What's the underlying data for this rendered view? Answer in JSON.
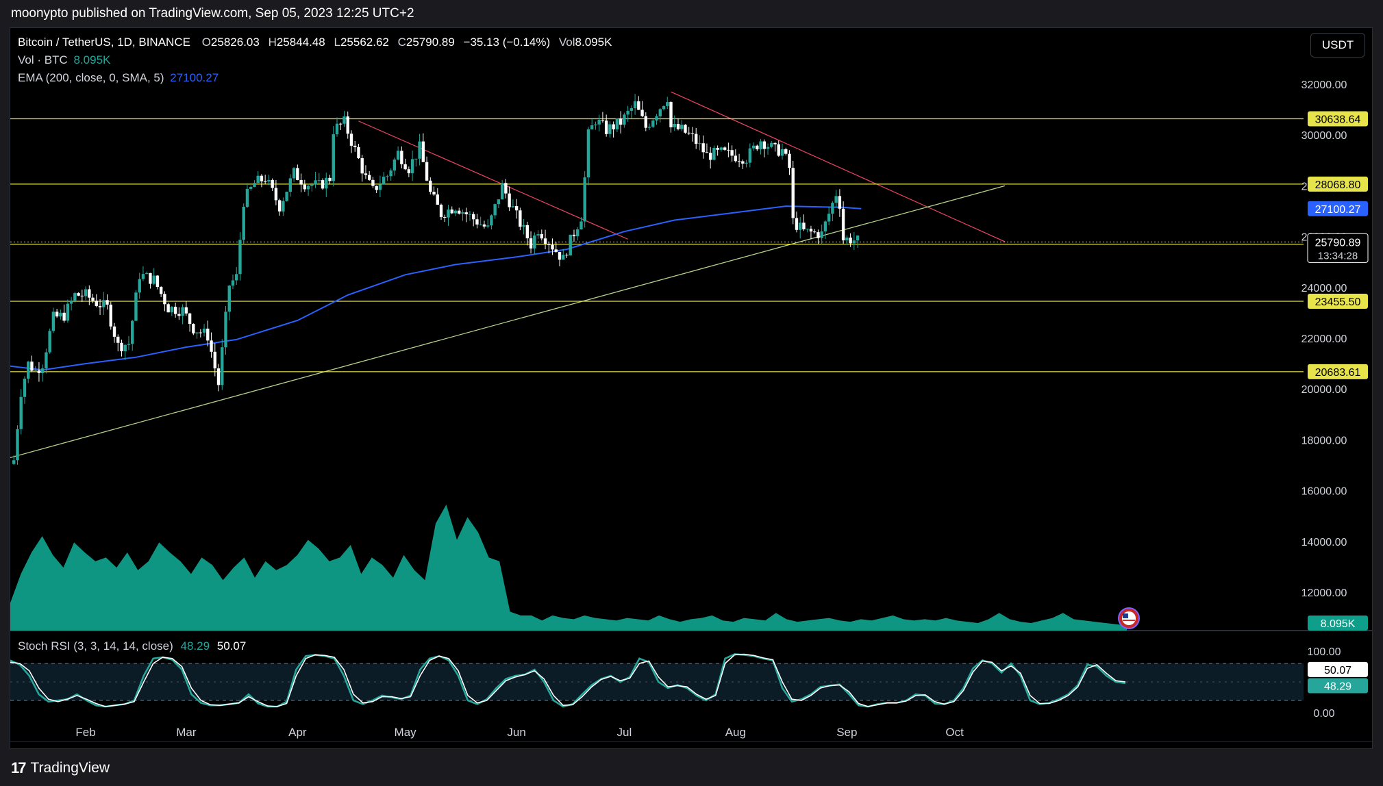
{
  "header": {
    "published_text": "moonypto published on TradingView.com, Sep 05, 2023 12:25 UTC+2"
  },
  "footer": {
    "brand": "TradingView",
    "logo_mark": "17"
  },
  "currency_button": "USDT",
  "legend": {
    "symbol": "Bitcoin / TetherUS, 1D, BINANCE",
    "o_label": "O",
    "o": "25826.03",
    "h_label": "H",
    "h": "25844.48",
    "l_label": "L",
    "l": "25562.62",
    "c_label": "C",
    "c": "25790.89",
    "change": "−35.13 (−0.14%)",
    "vol_label": "Vol",
    "vol": "8.095K",
    "volume_title": "Vol · BTC",
    "volume_value": "8.095K",
    "ema_title": "EMA (200, close, 0, SMA, 5)",
    "ema_value": "27100.27"
  },
  "stoch_legend": {
    "title": "Stoch RSI (3, 3, 14, 14, close)",
    "k": "48.29",
    "d": "50.07"
  },
  "colors": {
    "background": "#000000",
    "up_candle": "#26a69a",
    "down_candle": "#ffffff",
    "ema_line": "#2962ff",
    "level_line": "#e7e34a",
    "resistance_trend": "#e0435b",
    "support_trend": "#b5d18a",
    "volume_fill": "#0f9e8a",
    "stoch_k": "#26a69a",
    "stoch_d": "#ffffff"
  },
  "chart_data": [
    {
      "type": "candlestick",
      "title": "Bitcoin / TetherUS, 1D, BINANCE",
      "x_range": [
        "2023-01-11",
        "2023-10-15"
      ],
      "y_ticks": [
        "32000.00",
        "30000.00",
        "28000.00",
        "26000.00",
        "24000.00",
        "22000.00",
        "20000.00",
        "18000.00",
        "16000.00",
        "14000.00",
        "12000.00"
      ],
      "y_range": [
        10500,
        33300
      ],
      "x_ticks": [
        {
          "label": "Feb",
          "date": "2023-02-01"
        },
        {
          "label": "Mar",
          "date": "2023-03-01"
        },
        {
          "label": "Apr",
          "date": "2023-04-01"
        },
        {
          "label": "May",
          "date": "2023-05-01"
        },
        {
          "label": "Jun",
          "date": "2023-06-01"
        },
        {
          "label": "Jul",
          "date": "2023-07-01"
        },
        {
          "label": "Aug",
          "date": "2023-08-01"
        },
        {
          "label": "Sep",
          "date": "2023-09-01"
        },
        {
          "label": "Oct",
          "date": "2023-10-01"
        }
      ],
      "close_series": {
        "name": "BTCUSDT close",
        "points": [
          [
            "2023-01-12",
            17200
          ],
          [
            "2023-01-14",
            19900
          ],
          [
            "2023-01-16",
            21000
          ],
          [
            "2023-01-18",
            20700
          ],
          [
            "2023-01-20",
            21000
          ],
          [
            "2023-01-23",
            22800
          ],
          [
            "2023-01-26",
            22900
          ],
          [
            "2023-01-29",
            23700
          ],
          [
            "2023-02-01",
            23700
          ],
          [
            "2023-02-04",
            23400
          ],
          [
            "2023-02-07",
            23200
          ],
          [
            "2023-02-10",
            21700
          ],
          [
            "2023-02-13",
            21800
          ],
          [
            "2023-02-16",
            24500
          ],
          [
            "2023-02-20",
            24300
          ],
          [
            "2023-02-24",
            23200
          ],
          [
            "2023-02-28",
            23100
          ],
          [
            "2023-03-03",
            22400
          ],
          [
            "2023-03-07",
            22100
          ],
          [
            "2023-03-10",
            20200
          ],
          [
            "2023-03-13",
            24100
          ],
          [
            "2023-03-15",
            24400
          ],
          [
            "2023-03-17",
            27400
          ],
          [
            "2023-03-20",
            28100
          ],
          [
            "2023-03-23",
            28300
          ],
          [
            "2023-03-27",
            27200
          ],
          [
            "2023-03-31",
            28500
          ],
          [
            "2023-04-03",
            28100
          ],
          [
            "2023-04-07",
            28000
          ],
          [
            "2023-04-10",
            28300
          ],
          [
            "2023-04-11",
            30200
          ],
          [
            "2023-04-14",
            30500
          ],
          [
            "2023-04-17",
            29400
          ],
          [
            "2023-04-20",
            28300
          ],
          [
            "2023-04-22",
            27800
          ],
          [
            "2023-04-25",
            28300
          ],
          [
            "2023-04-26",
            28400
          ],
          [
            "2023-04-29",
            29300
          ],
          [
            "2023-05-02",
            28700
          ],
          [
            "2023-05-05",
            29500
          ],
          [
            "2023-05-08",
            27700
          ],
          [
            "2023-05-11",
            26900
          ],
          [
            "2023-05-15",
            27200
          ],
          [
            "2023-05-19",
            26800
          ],
          [
            "2023-05-24",
            26300
          ],
          [
            "2023-05-28",
            28000
          ],
          [
            "2023-06-01",
            26800
          ],
          [
            "2023-06-05",
            25700
          ],
          [
            "2023-06-07",
            26300
          ],
          [
            "2023-06-10",
            25800
          ],
          [
            "2023-06-14",
            25100
          ],
          [
            "2023-06-15",
            25500
          ],
          [
            "2023-06-19",
            26800
          ],
          [
            "2023-06-20",
            28300
          ],
          [
            "2023-06-21",
            30000
          ],
          [
            "2023-06-23",
            30600
          ],
          [
            "2023-06-26",
            30200
          ],
          [
            "2023-06-30",
            30500
          ],
          [
            "2023-07-04",
            31200
          ],
          [
            "2023-07-07",
            30300
          ],
          [
            "2023-07-13",
            31500
          ],
          [
            "2023-07-14",
            30300
          ],
          [
            "2023-07-17",
            30200
          ],
          [
            "2023-07-20",
            29900
          ],
          [
            "2023-07-24",
            29200
          ],
          [
            "2023-07-28",
            29300
          ],
          [
            "2023-07-31",
            29200
          ],
          [
            "2023-08-04",
            29100
          ],
          [
            "2023-08-08",
            29800
          ],
          [
            "2023-08-12",
            29400
          ],
          [
            "2023-08-14",
            29400
          ],
          [
            "2023-08-16",
            28700
          ],
          [
            "2023-08-17",
            26600
          ],
          [
            "2023-08-20",
            26200
          ],
          [
            "2023-08-25",
            26100
          ],
          [
            "2023-08-29",
            27700
          ],
          [
            "2023-08-30",
            27300
          ],
          [
            "2023-08-31",
            25900
          ],
          [
            "2023-09-02",
            25900
          ],
          [
            "2023-09-05",
            25790.89
          ]
        ]
      },
      "ema200": {
        "name": "EMA (200, close, 0, SMA, 5)",
        "points": [
          [
            "2023-01-11",
            20900
          ],
          [
            "2023-01-20",
            20750
          ],
          [
            "2023-02-01",
            21000
          ],
          [
            "2023-02-15",
            21250
          ],
          [
            "2023-03-01",
            21650
          ],
          [
            "2023-03-15",
            21950
          ],
          [
            "2023-04-01",
            22700
          ],
          [
            "2023-04-15",
            23700
          ],
          [
            "2023-05-01",
            24500
          ],
          [
            "2023-05-15",
            24900
          ],
          [
            "2023-06-01",
            25200
          ],
          [
            "2023-06-15",
            25500
          ],
          [
            "2023-07-01",
            26200
          ],
          [
            "2023-07-15",
            26650
          ],
          [
            "2023-08-01",
            26950
          ],
          [
            "2023-08-15",
            27200
          ],
          [
            "2023-08-31",
            27150
          ],
          [
            "2023-09-05",
            27100.27
          ]
        ]
      },
      "horizontal_levels": [
        {
          "value": 30638.64,
          "label": "30638.64"
        },
        {
          "value": 28068.8,
          "label": "28068.80"
        },
        {
          "value": 25701.83,
          "label": "25701.83"
        },
        {
          "value": 23455.5,
          "label": "23455.50"
        },
        {
          "value": 20683.61,
          "label": "20683.61"
        }
      ],
      "price_labels": [
        {
          "value": 27100.27,
          "label": "27100.27",
          "kind": "ema"
        },
        {
          "value": 25790.89,
          "label": "25790.89",
          "sub": "13:34:28",
          "kind": "last"
        }
      ],
      "trend_lines": [
        {
          "name": "resistance-1",
          "from": [
            "2023-04-18",
            30550
          ],
          "to": [
            "2023-07-02",
            25900
          ]
        },
        {
          "name": "resistance-2",
          "from": [
            "2023-07-14",
            31700
          ],
          "to": [
            "2023-10-15",
            25800
          ]
        },
        {
          "name": "support",
          "from": [
            "2023-01-11",
            17300
          ],
          "to": [
            "2023-10-15",
            28000
          ]
        }
      ]
    },
    {
      "type": "area",
      "title": "Vol · BTC",
      "last_value": "8.095K",
      "y_range": [
        0,
        1
      ],
      "relative_values": [
        0.22,
        0.45,
        0.62,
        0.75,
        0.6,
        0.5,
        0.7,
        0.62,
        0.55,
        0.58,
        0.5,
        0.62,
        0.48,
        0.55,
        0.7,
        0.62,
        0.55,
        0.45,
        0.58,
        0.52,
        0.4,
        0.5,
        0.58,
        0.42,
        0.55,
        0.48,
        0.52,
        0.6,
        0.72,
        0.65,
        0.55,
        0.58,
        0.68,
        0.45,
        0.58,
        0.52,
        0.42,
        0.6,
        0.48,
        0.4,
        0.85,
        1.0,
        0.72,
        0.9,
        0.78,
        0.58,
        0.55,
        0.15,
        0.12,
        0.12,
        0.08,
        0.12,
        0.1,
        0.09,
        0.12,
        0.1,
        0.09,
        0.08,
        0.1,
        0.09,
        0.08,
        0.12,
        0.09,
        0.07,
        0.09,
        0.1,
        0.12,
        0.08,
        0.07,
        0.1,
        0.09,
        0.08,
        0.14,
        0.09,
        0.07,
        0.08,
        0.09,
        0.1,
        0.08,
        0.07,
        0.09,
        0.08,
        0.1,
        0.12,
        0.09,
        0.08,
        0.09,
        0.08,
        0.1,
        0.08,
        0.07,
        0.06,
        0.09,
        0.14,
        0.09,
        0.07,
        0.06,
        0.08,
        0.1,
        0.14,
        0.09,
        0.08,
        0.07,
        0.06,
        0.05,
        0.04
      ]
    },
    {
      "type": "line",
      "title": "Stoch RSI (3, 3, 14, 14, close)",
      "y_range": [
        0,
        100
      ],
      "y_ticks": [
        "100.00",
        "0.00"
      ],
      "bands": [
        80,
        20
      ],
      "series": [
        {
          "name": "K",
          "last": 48.29,
          "values": [
            85,
            78,
            60,
            30,
            18,
            20,
            22,
            30,
            20,
            12,
            10,
            12,
            14,
            20,
            60,
            88,
            90,
            86,
            70,
            30,
            16,
            12,
            12,
            14,
            16,
            30,
            15,
            10,
            10,
            18,
            70,
            92,
            94,
            92,
            88,
            60,
            20,
            14,
            20,
            28,
            25,
            22,
            28,
            70,
            88,
            92,
            85,
            60,
            20,
            14,
            22,
            40,
            55,
            60,
            62,
            70,
            50,
            20,
            10,
            14,
            30,
            45,
            55,
            60,
            50,
            58,
            88,
            82,
            50,
            40,
            45,
            40,
            28,
            20,
            30,
            88,
            95,
            94,
            92,
            88,
            85,
            40,
            18,
            22,
            30,
            42,
            44,
            46,
            30,
            12,
            10,
            14,
            16,
            16,
            20,
            30,
            28,
            15,
            14,
            20,
            40,
            72,
            85,
            80,
            65,
            80,
            60,
            20,
            14,
            16,
            22,
            30,
            45,
            78,
            75,
            60,
            50,
            48
          ]
        },
        {
          "name": "D",
          "last": 50.07,
          "values": [
            82,
            80,
            68,
            40,
            22,
            18,
            22,
            28,
            22,
            15,
            10,
            12,
            14,
            18,
            50,
            80,
            90,
            88,
            75,
            40,
            20,
            13,
            12,
            14,
            16,
            26,
            18,
            11,
            10,
            15,
            60,
            88,
            94,
            93,
            90,
            70,
            30,
            16,
            18,
            26,
            26,
            23,
            26,
            60,
            85,
            92,
            88,
            68,
            28,
            16,
            20,
            36,
            52,
            58,
            62,
            68,
            55,
            28,
            12,
            13,
            26,
            42,
            54,
            59,
            52,
            56,
            80,
            84,
            58,
            42,
            44,
            42,
            30,
            22,
            28,
            80,
            94,
            95,
            93,
            89,
            86,
            50,
            22,
            20,
            28,
            40,
            44,
            45,
            34,
            15,
            10,
            13,
            16,
            16,
            19,
            28,
            29,
            18,
            14,
            18,
            36,
            66,
            84,
            82,
            68,
            76,
            64,
            28,
            15,
            15,
            20,
            28,
            42,
            72,
            78,
            64,
            52,
            50
          ]
        }
      ]
    }
  ]
}
